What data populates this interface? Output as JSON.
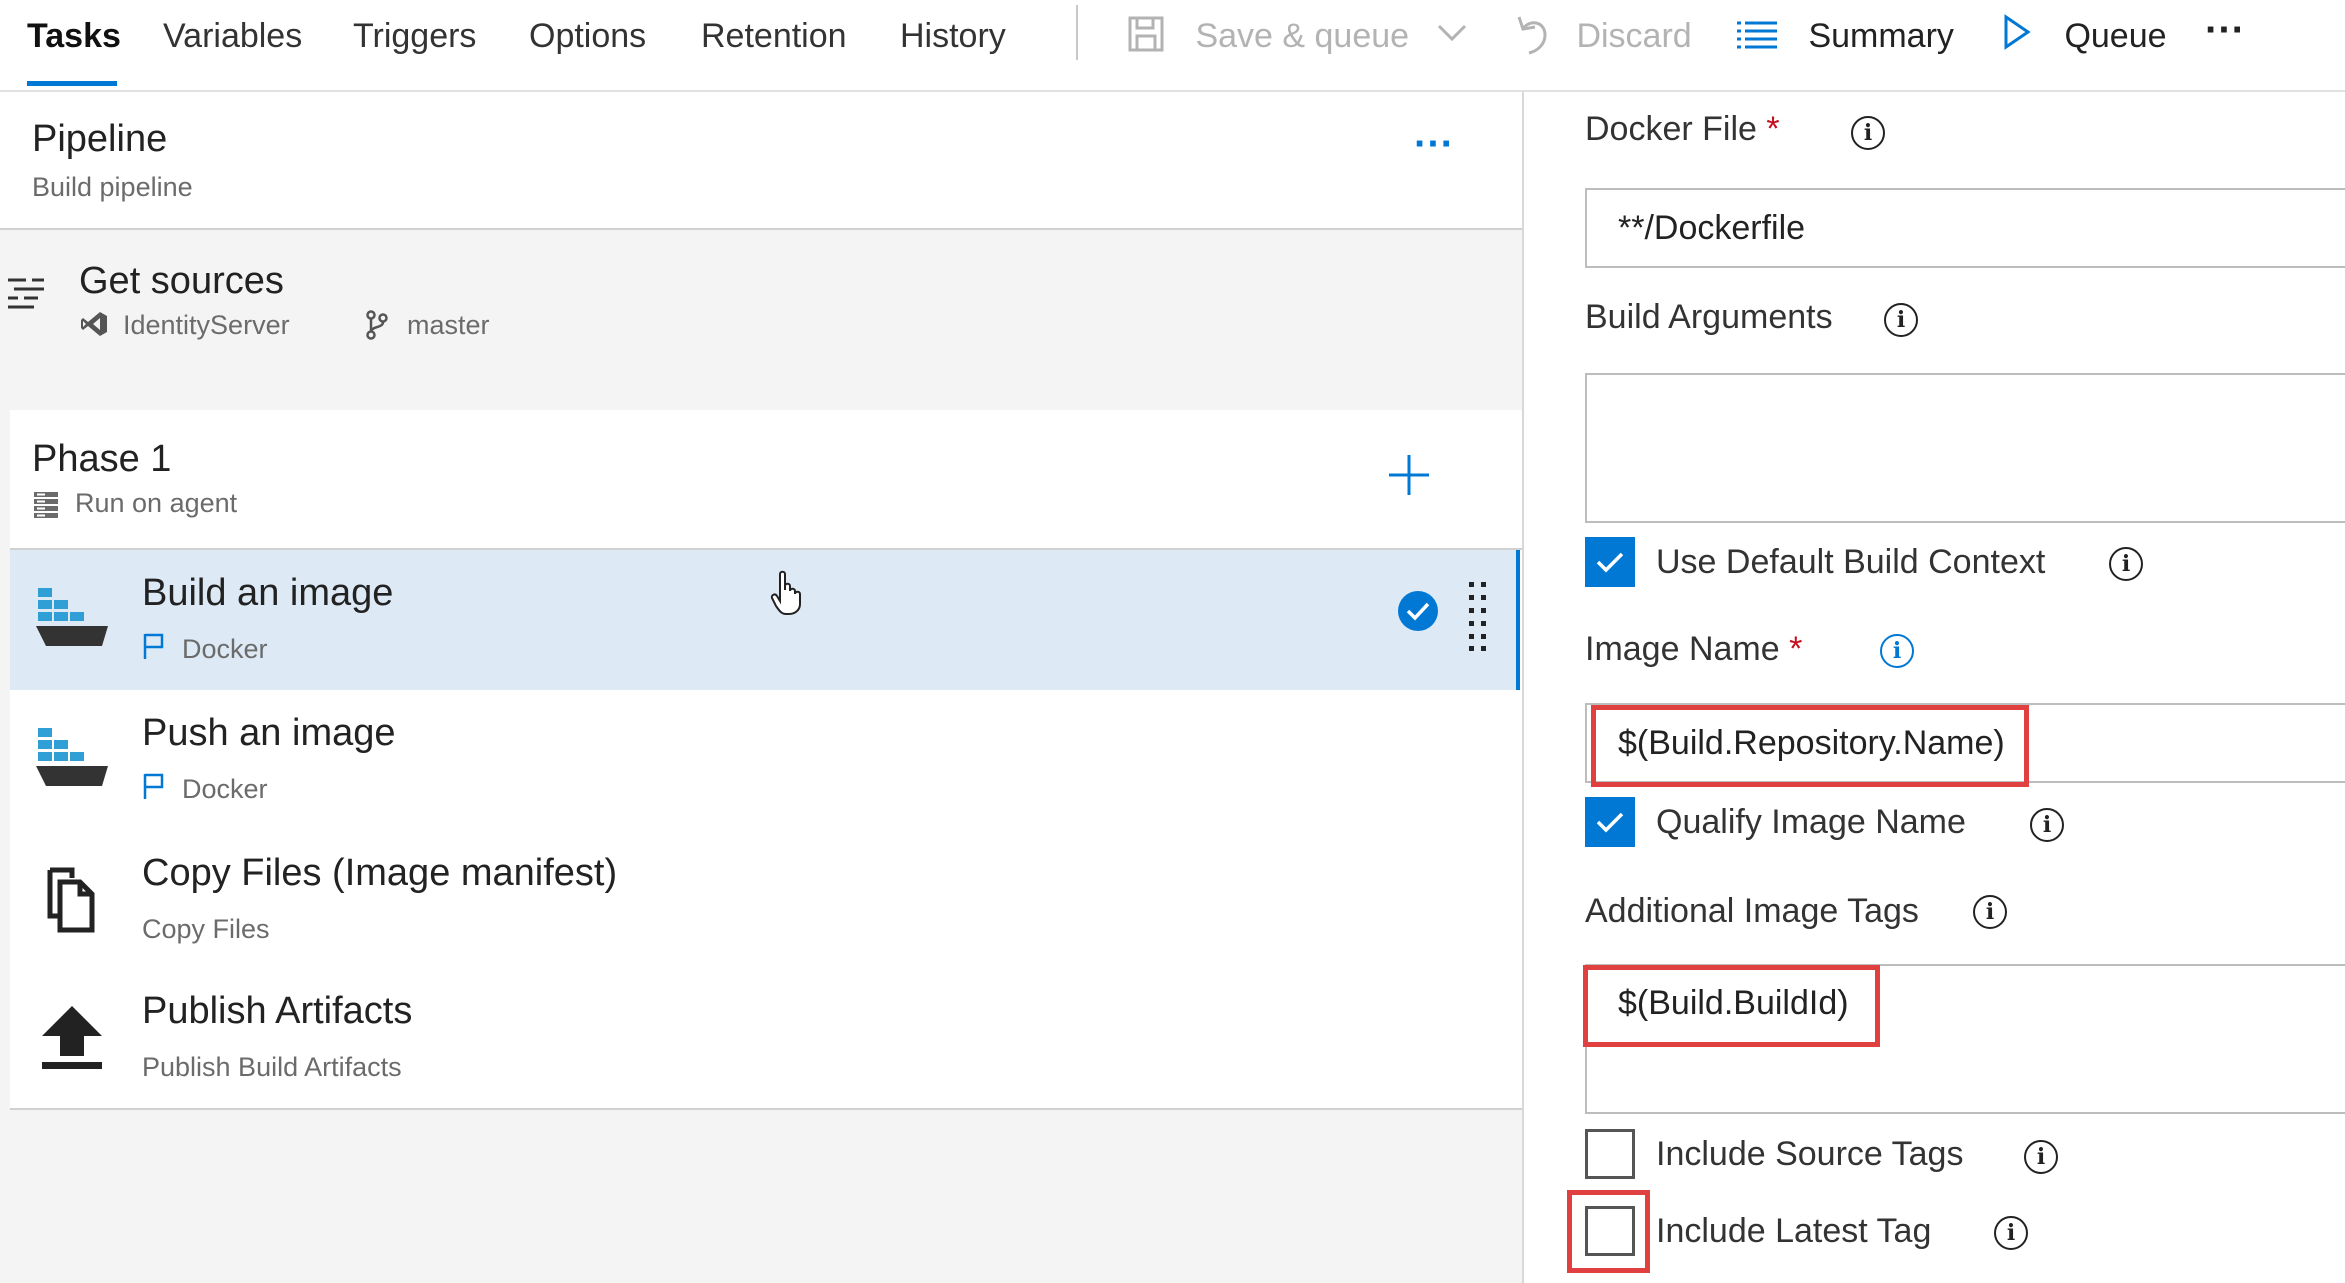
{
  "tabs": [
    "Tasks",
    "Variables",
    "Triggers",
    "Options",
    "Retention",
    "History"
  ],
  "toolbar": {
    "save_queue": "Save & queue",
    "discard": "Discard",
    "summary": "Summary",
    "queue": "Queue",
    "more": "···"
  },
  "pipeline": {
    "title": "Pipeline",
    "subtitle": "Build pipeline",
    "more": "···"
  },
  "sources": {
    "title": "Get sources",
    "repo": "IdentityServer",
    "branch": "master"
  },
  "phase": {
    "title": "Phase 1",
    "subtitle": "Run on agent"
  },
  "tasks": [
    {
      "title": "Build an image",
      "subtitle": "Docker"
    },
    {
      "title": "Push an image",
      "subtitle": "Docker"
    },
    {
      "title": "Copy Files (Image manifest)",
      "subtitle": "Copy Files"
    },
    {
      "title": "Publish Artifacts",
      "subtitle": "Publish Build Artifacts"
    }
  ],
  "form": {
    "docker_file_label": "Docker File",
    "docker_file_value": "**/Dockerfile",
    "build_args_label": "Build Arguments",
    "build_args_value": "",
    "default_context_label": "Use Default Build Context",
    "default_context_checked": true,
    "image_name_label": "Image Name",
    "image_name_value": "$(Build.Repository.Name)",
    "qualify_label": "Qualify Image Name",
    "qualify_checked": true,
    "tags_label": "Additional Image Tags",
    "tags_value": "$(Build.BuildId)",
    "source_tags_label": "Include Source Tags",
    "source_tags_checked": false,
    "latest_tag_label": "Include Latest Tag",
    "latest_tag_checked": false,
    "required_mark": "*"
  },
  "colors": {
    "accent": "#0078d4",
    "highlight": "#e04040",
    "selected_row": "#ddeaf6"
  }
}
